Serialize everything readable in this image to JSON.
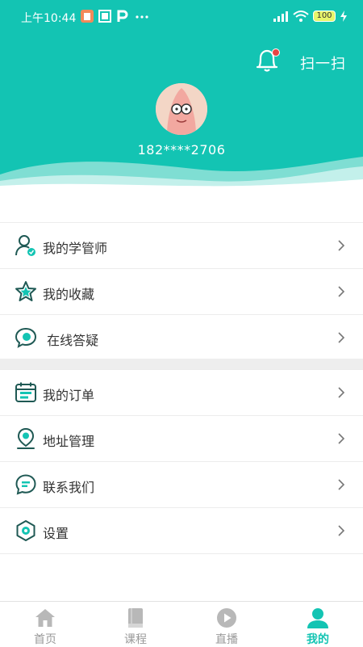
{
  "colors": {
    "accent": "#13c4b3",
    "badge": "#e64545",
    "icon": "#1f5954",
    "inactive": "#b8b8b8"
  },
  "status_bar": {
    "time": "上午10:44",
    "battery": "100",
    "icons": [
      "notification-icon",
      "app-icon",
      "p-icon",
      "more-dots-icon",
      "signal-icon",
      "wifi-icon",
      "battery-icon",
      "charging-icon"
    ]
  },
  "header": {
    "scan_label": "扫一扫",
    "phone": "182****2706"
  },
  "menu_group_1": [
    {
      "label": "我的学管师",
      "icon": "tutor-icon"
    },
    {
      "label": "我的收藏",
      "icon": "star-icon"
    },
    {
      "label": " 在线答疑",
      "icon": "chat-question-icon"
    }
  ],
  "menu_group_2": [
    {
      "label": "我的订单",
      "icon": "calendar-order-icon"
    },
    {
      "label": "地址管理",
      "icon": "location-icon"
    },
    {
      "label": "联系我们",
      "icon": "contact-chat-icon"
    },
    {
      "label": "设置",
      "icon": "settings-icon"
    }
  ],
  "tabs": [
    {
      "label": "首页",
      "icon": "home-icon",
      "active": false
    },
    {
      "label": "课程",
      "icon": "book-icon",
      "active": false
    },
    {
      "label": "直播",
      "icon": "play-icon",
      "active": false
    },
    {
      "label": "我的",
      "icon": "person-icon",
      "active": true
    }
  ]
}
